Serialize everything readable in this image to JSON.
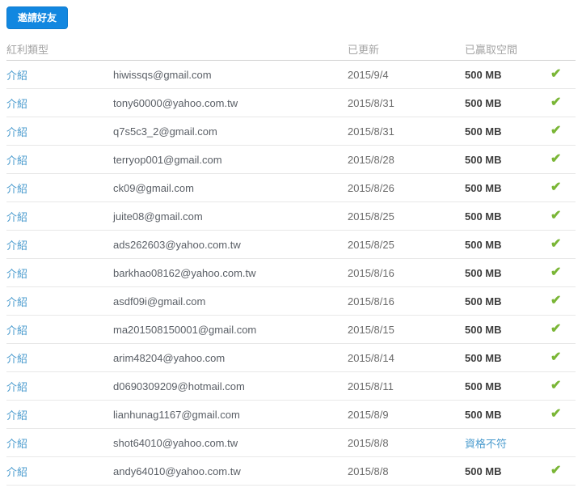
{
  "toolbar": {
    "invite_button_label": "邀請好友"
  },
  "colors": {
    "button_blue": "#1287e0",
    "link_blue": "#4a9bce",
    "check_green": "#7ab636"
  },
  "icons": {
    "check": "✔"
  },
  "table": {
    "headers": {
      "type": "紅利類型",
      "updated": "已更新",
      "space": "已贏取空間"
    },
    "rows": [
      {
        "type": "介紹",
        "email": "hiwissqs@gmail.com",
        "updated": "2015/9/4",
        "space": "500 MB",
        "earned": true
      },
      {
        "type": "介紹",
        "email": "tony60000@yahoo.com.tw",
        "updated": "2015/8/31",
        "space": "500 MB",
        "earned": true
      },
      {
        "type": "介紹",
        "email": "q7s5c3_2@gmail.com",
        "updated": "2015/8/31",
        "space": "500 MB",
        "earned": true
      },
      {
        "type": "介紹",
        "email": "terryop001@gmail.com",
        "updated": "2015/8/28",
        "space": "500 MB",
        "earned": true
      },
      {
        "type": "介紹",
        "email": "ck09@gmail.com",
        "updated": "2015/8/26",
        "space": "500 MB",
        "earned": true
      },
      {
        "type": "介紹",
        "email": "juite08@gmail.com",
        "updated": "2015/8/25",
        "space": "500 MB",
        "earned": true
      },
      {
        "type": "介紹",
        "email": "ads262603@yahoo.com.tw",
        "updated": "2015/8/25",
        "space": "500 MB",
        "earned": true
      },
      {
        "type": "介紹",
        "email": "barkhao08162@yahoo.com.tw",
        "updated": "2015/8/16",
        "space": "500 MB",
        "earned": true
      },
      {
        "type": "介紹",
        "email": "asdf09i@gmail.com",
        "updated": "2015/8/16",
        "space": "500 MB",
        "earned": true
      },
      {
        "type": "介紹",
        "email": "ma201508150001@gmail.com",
        "updated": "2015/8/15",
        "space": "500 MB",
        "earned": true
      },
      {
        "type": "介紹",
        "email": "arim48204@yahoo.com",
        "updated": "2015/8/14",
        "space": "500 MB",
        "earned": true
      },
      {
        "type": "介紹",
        "email": "d0690309209@hotmail.com",
        "updated": "2015/8/11",
        "space": "500 MB",
        "earned": true
      },
      {
        "type": "介紹",
        "email": "lianhunag1167@gmail.com",
        "updated": "2015/8/9",
        "space": "500 MB",
        "earned": true
      },
      {
        "type": "介紹",
        "email": "shot64010@yahoo.com.tw",
        "updated": "2015/8/8",
        "space": "資格不符",
        "earned": false
      },
      {
        "type": "介紹",
        "email": "andy64010@yahoo.com.tw",
        "updated": "2015/8/8",
        "space": "500 MB",
        "earned": true
      }
    ]
  }
}
